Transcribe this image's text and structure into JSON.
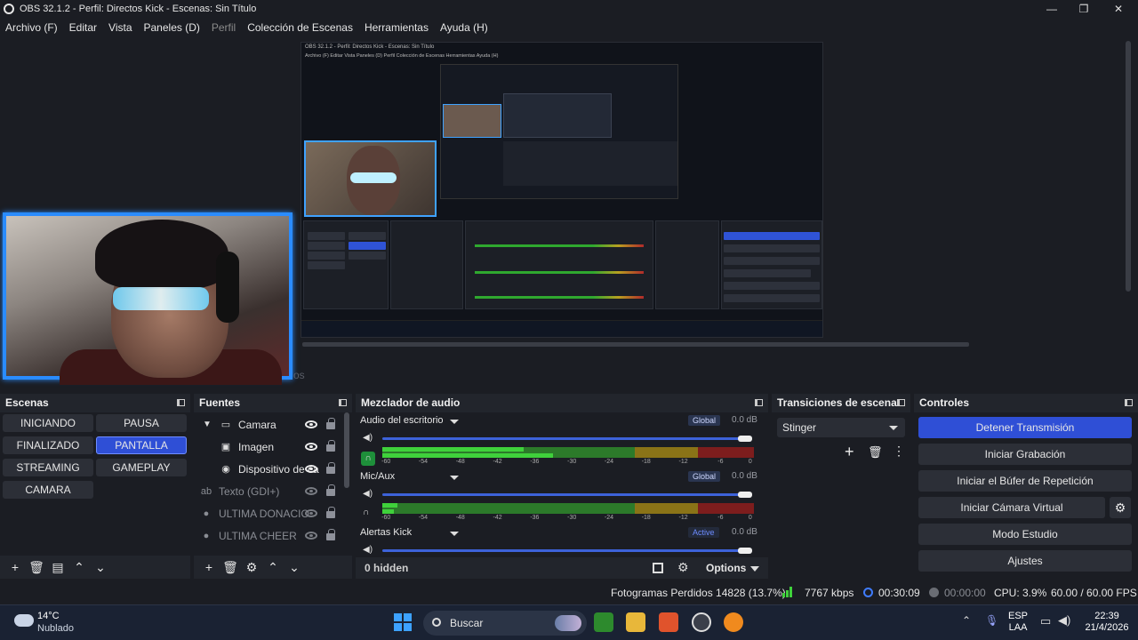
{
  "window": {
    "title": "OBS 32.1.2 - Perfil: Directos Kick - Escenas: Sin Título",
    "minimize": "—",
    "maximize": "❐",
    "close": "✕"
  },
  "menu": [
    "Archivo (F)",
    "Editar",
    "Vista",
    "Paneles (D)",
    "Perfil",
    "Colección de Escenas",
    "Herramientas",
    "Ayuda (H)"
  ],
  "preview": {
    "ghost_text": "os",
    "mini": {
      "title": "OBS 32.1.2 - Perfil: Directos Kick - Escenas: Sin Título",
      "menu": "Archivo (F)   Editar   Vista   Paneles (D)   Perfil   Colección de Escenas   Herramientas   Ayuda (H)"
    }
  },
  "scenes": {
    "title": "Escenas",
    "items": [
      "INICIANDO",
      "PAUSA",
      "FINALIZADO",
      "PANTALLA",
      "STREAMING",
      "GAMEPLAY",
      "CAMARA"
    ],
    "active": "PANTALLA"
  },
  "sources": {
    "title": "Fuentes",
    "items": [
      {
        "name": "Camara",
        "icon": "folder-icon",
        "visible": true,
        "dim": false
      },
      {
        "name": "Imagen",
        "icon": "image-icon",
        "visible": true,
        "dim": false
      },
      {
        "name": "Dispositivo de ca",
        "icon": "camera-icon",
        "visible": true,
        "dim": false
      },
      {
        "name": "Texto (GDI+)",
        "icon": "text-icon",
        "visible": false,
        "dim": true
      },
      {
        "name": "ULTIMA DONACIO",
        "icon": "browser-icon",
        "visible": false,
        "dim": true
      },
      {
        "name": "ULTIMA CHEER",
        "icon": "browser-icon",
        "visible": false,
        "dim": true
      }
    ]
  },
  "mixer": {
    "title": "Mezclador de audio",
    "channels": [
      {
        "name": "Audio del escritorio",
        "badge": "Global",
        "db": "0.0 dB"
      },
      {
        "name": "Mic/Aux",
        "badge": "Global",
        "db": "0.0 dB"
      },
      {
        "name": "Alertas Kick",
        "badge": "Active",
        "db": "0.0 dB"
      }
    ],
    "scale": [
      "-60",
      "-54",
      "-48",
      "-42",
      "-36",
      "-30",
      "-24",
      "-18",
      "-12",
      "-6",
      "0"
    ],
    "hidden": "0 hidden",
    "options": "Options"
  },
  "transitions": {
    "title": "Transiciones de escena",
    "selected": "Stinger"
  },
  "controls": {
    "title": "Controles",
    "buttons": [
      "Detener Transmisión",
      "Iniciar Grabación",
      "Iniciar el Búfer de Repetición",
      "Iniciar Cámara Virtual",
      "Modo Estudio",
      "Ajustes"
    ]
  },
  "status": {
    "dropped": "Fotogramas Perdidos 14828 (13.7%)",
    "kbps": "7767 kbps",
    "live_time": "00:30:09",
    "rec_time": "00:00:00",
    "cpu": "CPU: 3.9%",
    "fps": "60.00 / 60.00 FPS"
  },
  "taskbar": {
    "temp": "14°C",
    "weather": "Nublado",
    "search": "Buscar",
    "lang": "ESP",
    "lang2": "LAA",
    "time": "22:39",
    "date": "21/4/2026"
  },
  "colors": {
    "accent": "#2f4fd6",
    "background": "#1b1d23",
    "dock": "#22252c",
    "meter_green": "#3fd13b"
  }
}
